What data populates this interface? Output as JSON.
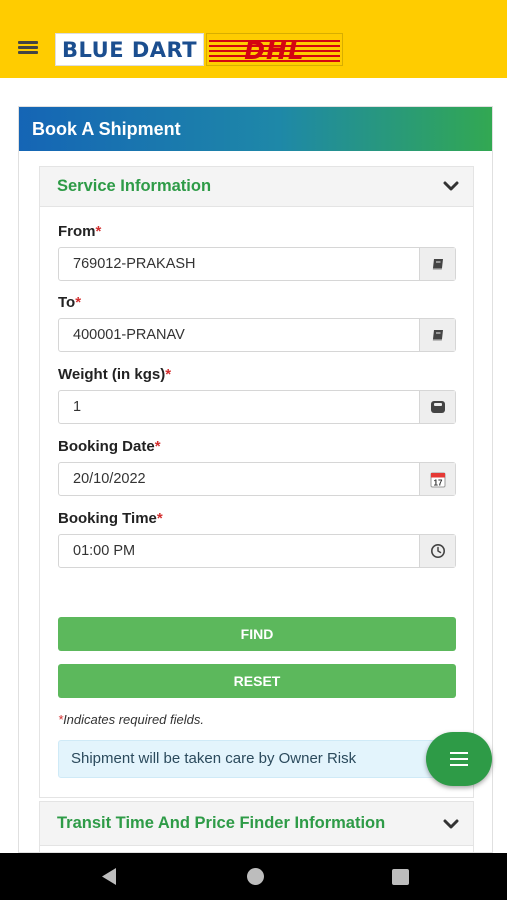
{
  "header": {
    "logo_blue_dart": "BLUE DART",
    "logo_dhl": "DHL"
  },
  "card": {
    "title": "Book A Shipment"
  },
  "service_section": {
    "title": "Service Information",
    "fields": {
      "from": {
        "label": "From",
        "value": "769012-PRAKASH",
        "icon": "book-icon"
      },
      "to": {
        "label": "To",
        "value": "400001-PRANAV",
        "icon": "book-icon"
      },
      "weight": {
        "label": "Weight (in kgs)",
        "value": "1",
        "icon": "weight-scale-icon"
      },
      "booking_date": {
        "label": "Booking Date",
        "value": "20/10/2022",
        "icon": "calendar-icon",
        "calendar_day": "17"
      },
      "booking_time": {
        "label": "Booking Time",
        "value": "01:00 PM",
        "icon": "clock-icon"
      }
    },
    "required_marker": "*",
    "find_label": "FIND",
    "reset_label": "RESET",
    "required_note": "Indicates required fields.",
    "alert_text": "Shipment will be taken care by Owner Risk"
  },
  "transit_section": {
    "title": "Transit Time And Price Finder Information"
  },
  "colors": {
    "brand_yellow": "#FFCC00",
    "header_gradient_start": "#1565b5",
    "header_gradient_end": "#32a852",
    "accent_green": "#2e9b47",
    "button_green": "#5cb85c",
    "required_red": "#d32f2f"
  }
}
